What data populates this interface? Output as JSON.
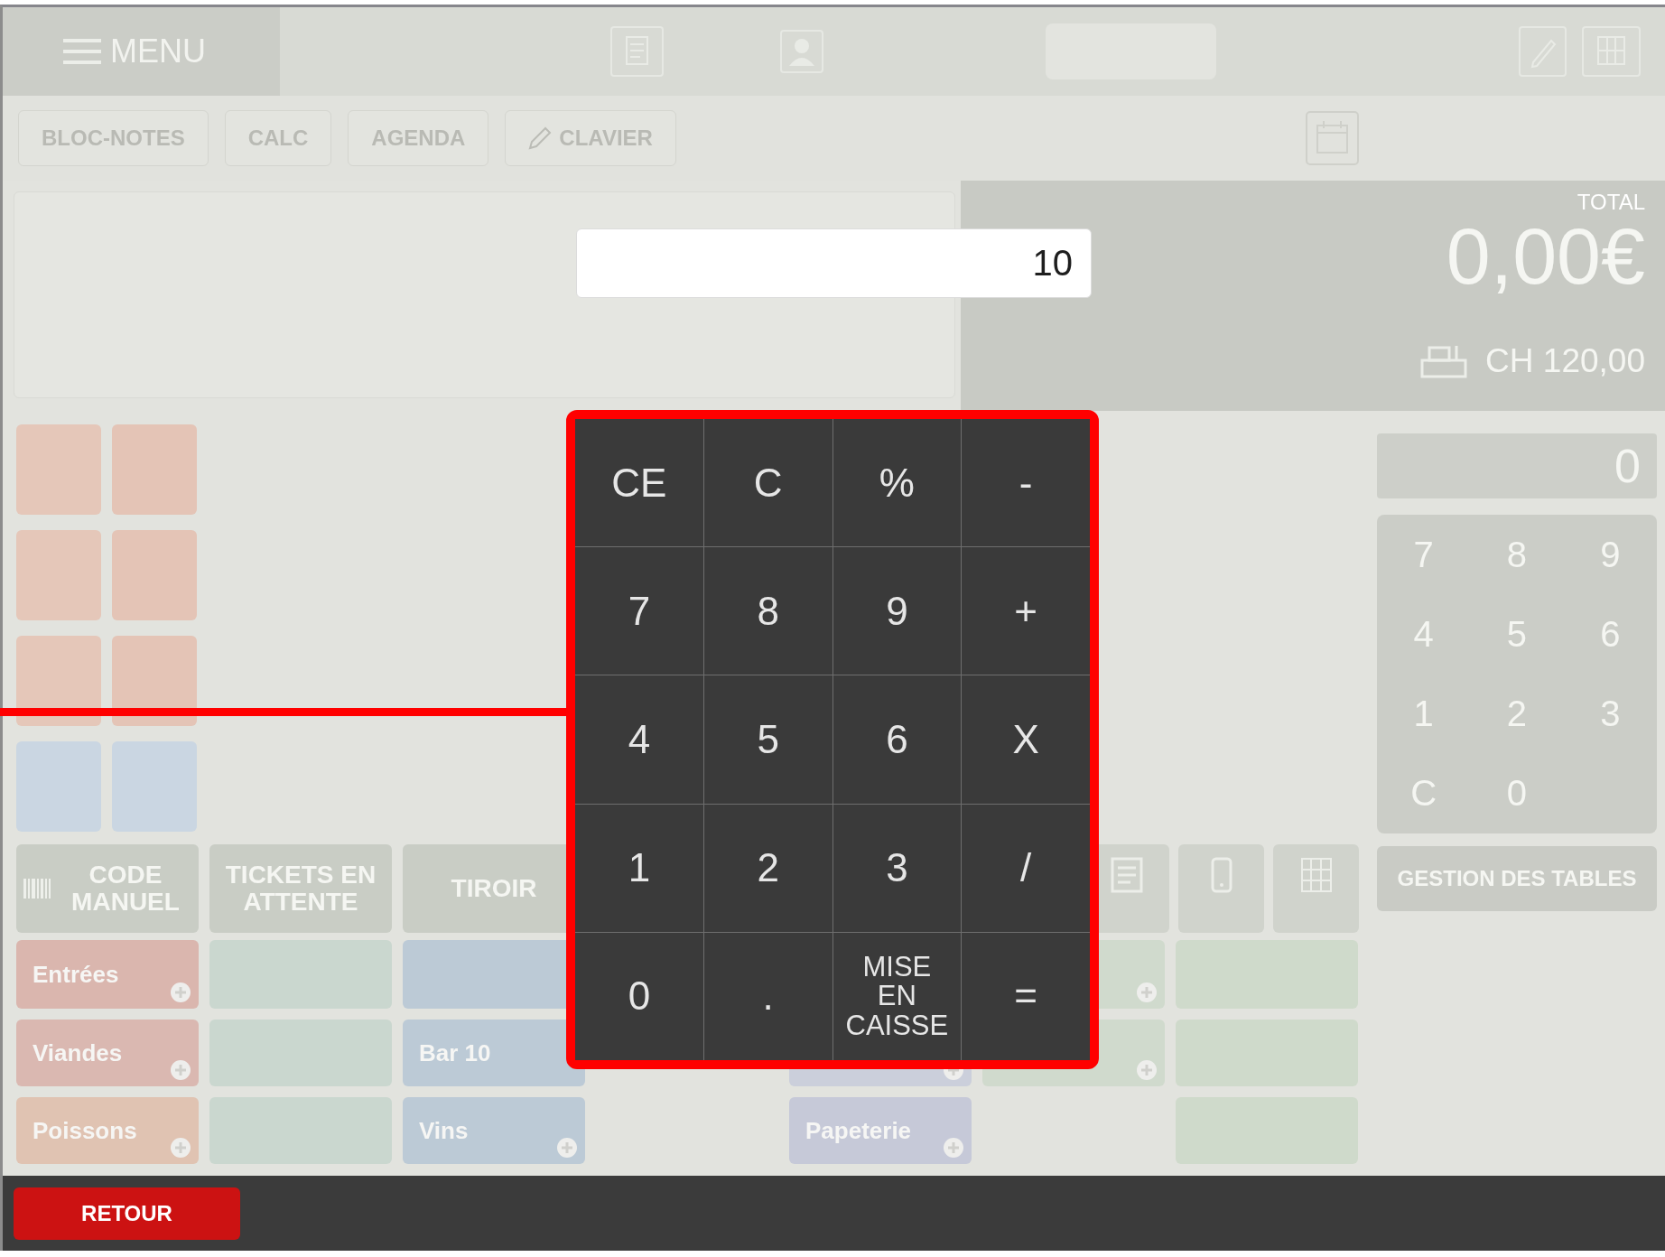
{
  "header": {
    "menu_label": "MENU"
  },
  "toolbar": {
    "buttons": [
      {
        "label": "BLOC-NOTES",
        "kind": "text"
      },
      {
        "label": "CALC",
        "kind": "text"
      },
      {
        "label": "AGENDA",
        "kind": "text"
      },
      {
        "label": "CLAVIER",
        "kind": "pencil"
      }
    ]
  },
  "total_panel": {
    "heading": "TOTAL",
    "amount": "0,00€",
    "cash": "CH 120,00"
  },
  "calculator": {
    "value": "10",
    "rows": [
      {
        "keys": [
          {
            "label": "CE",
            "kind": "symbol"
          },
          {
            "label": "C",
            "kind": "symbol"
          },
          {
            "label": "%",
            "kind": "symbol"
          },
          {
            "label": "-",
            "kind": "symbol"
          }
        ]
      },
      {
        "keys": [
          {
            "label": "7",
            "kind": "symbol"
          },
          {
            "label": "8",
            "kind": "symbol"
          },
          {
            "label": "9",
            "kind": "symbol"
          },
          {
            "label": "+",
            "kind": "symbol"
          }
        ]
      },
      {
        "keys": [
          {
            "label": "4",
            "kind": "symbol"
          },
          {
            "label": "5",
            "kind": "symbol"
          },
          {
            "label": "6",
            "kind": "symbol"
          },
          {
            "label": "X",
            "kind": "symbol"
          }
        ]
      },
      {
        "keys": [
          {
            "label": "1",
            "kind": "symbol"
          },
          {
            "label": "2",
            "kind": "symbol"
          },
          {
            "label": "3",
            "kind": "symbol"
          },
          {
            "label": "/",
            "kind": "symbol"
          }
        ]
      },
      {
        "keys": [
          {
            "label": "0",
            "kind": "symbol"
          },
          {
            "label": ".",
            "kind": "symbol"
          },
          {
            "label": "MISE EN CAISSE",
            "kind": "text"
          },
          {
            "label": "=",
            "kind": "symbol"
          }
        ]
      }
    ]
  },
  "products": [
    {
      "color": "#e5c7b9"
    },
    {
      "color": "#e4c4b6"
    },
    {
      "color": "#e5c7b9"
    },
    {
      "color": "#e4c4b6"
    },
    {
      "color": "#e5c7b9"
    },
    {
      "color": "#e4c4b6"
    },
    {
      "color": "#cad6e2"
    },
    {
      "color": "#cad6e2"
    }
  ],
  "numpad": {
    "display": "0",
    "keys": [
      "7",
      "8",
      "9",
      "4",
      "5",
      "6",
      "1",
      "2",
      "3",
      "C",
      "0"
    ]
  },
  "tables_button": "GESTION DES TABLES",
  "actions": [
    {
      "label": "CODE MANUEL",
      "kind": "barcode"
    },
    {
      "label": "TICKETS EN ATTENTE",
      "kind": "text"
    },
    {
      "label": "TIROIR",
      "kind": "text"
    }
  ],
  "tile_rows": [
    {
      "tiles": [
        {
          "kind": "folder",
          "label": "Entrées",
          "color": "#dab6ae"
        },
        {
          "kind": "product",
          "color": "#cad7cf"
        },
        {
          "kind": "product",
          "color": "#bccad6"
        },
        {
          "kind": "empty"
        },
        {
          "kind": "empty"
        },
        {
          "kind": "folder",
          "color": "#d0dacd"
        },
        {
          "kind": "product",
          "color": "#cfdacb"
        }
      ]
    },
    {
      "tiles": [
        {
          "kind": "folder",
          "label": "Viandes",
          "color": "#dab8b1"
        },
        {
          "kind": "product",
          "color": "#cad7cf"
        },
        {
          "kind": "product",
          "label": "Bar 10",
          "color": "#bccad6"
        },
        {
          "kind": "empty"
        },
        {
          "kind": "folder",
          "color": "#cbcfdb"
        },
        {
          "kind": "folder",
          "color": "#d0dacd"
        },
        {
          "kind": "product",
          "color": "#cfdacb"
        }
      ]
    },
    {
      "tiles": [
        {
          "kind": "folder",
          "label": "Poissons",
          "color": "#e0c3b2"
        },
        {
          "kind": "product",
          "color": "#cad7cf"
        },
        {
          "kind": "folder",
          "label": "Vins",
          "color": "#bccad6"
        },
        {
          "kind": "empty"
        },
        {
          "kind": "folder",
          "label": "Papeterie",
          "color": "#c6c9d8"
        },
        {
          "kind": "empty"
        },
        {
          "kind": "product",
          "color": "#cfdacb"
        }
      ]
    }
  ],
  "footer": {
    "back_button": "RETOUR"
  }
}
